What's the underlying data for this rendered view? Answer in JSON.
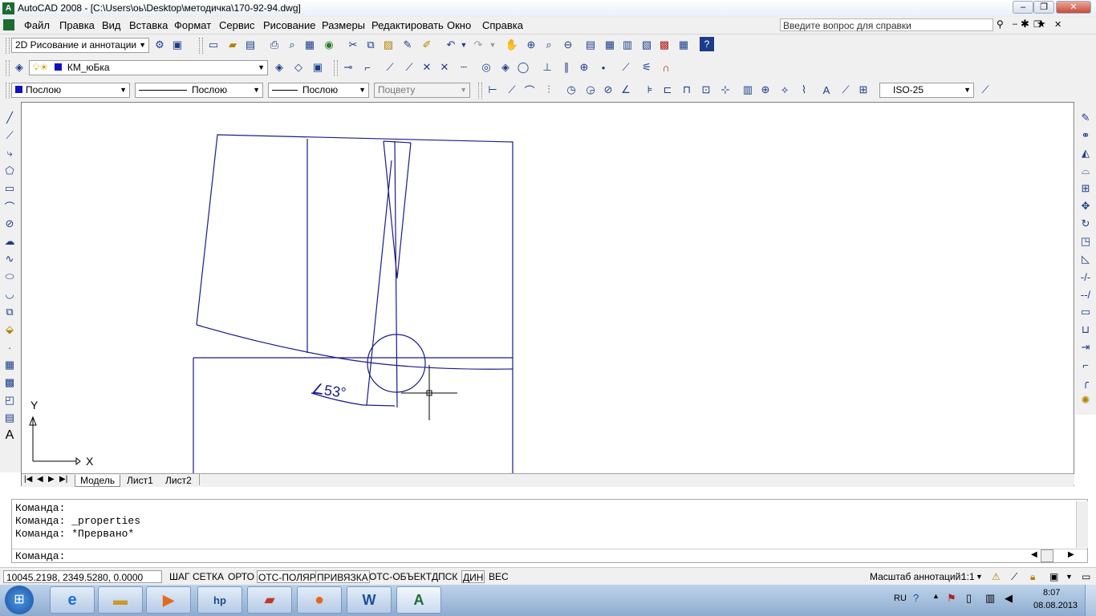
{
  "window": {
    "title": "AutoCAD 2008 - [C:\\Users\\оь\\Desktop\\методичка\\170-92-94.dwg]",
    "app_icon_label": "A",
    "minimize": "‒",
    "restore": "❐",
    "close": "✕"
  },
  "menu": {
    "items": [
      "Файл",
      "Правка",
      "Вид",
      "Вставка",
      "Формат",
      "Сервис",
      "Рисование",
      "Размеры",
      "Редактировать",
      "Окно",
      "Справка"
    ],
    "help_placeholder": "Введите вопрос для справки"
  },
  "toolbar1": {
    "workspace": "2D Рисование и аннотации"
  },
  "toolbar2": {
    "layer": "КМ_юБка"
  },
  "toolbar3": {
    "color": "Послою",
    "linetype": "Послою",
    "lineweight": "Послою",
    "plotstyle": "Поцвету",
    "dimstyle": "ISO-25"
  },
  "drawing": {
    "dimension_text": "∠53°",
    "ucs_x": "X",
    "ucs_y": "Y"
  },
  "tabs": [
    "Модель",
    "Лист1",
    "Лист2"
  ],
  "command": {
    "lines": [
      "Команда:",
      "Команда: _properties",
      "Команда: *Прервано*"
    ],
    "prompt": "Команда:"
  },
  "status": {
    "coords": "10045.2198, 2349.5280, 0.0000",
    "buttons": [
      "ШАГ",
      "СЕТКА",
      "ОРТО",
      "ОТС-ПОЛЯР",
      "ПРИВЯЗКА",
      "ОТС-ОБЪЕКТ",
      "ДПСК",
      "ДИН",
      "ВЕС"
    ],
    "annotation_scale_label": "Масштаб аннотаций:",
    "annotation_scale": "1:1"
  },
  "taskbar": {
    "lang": "RU",
    "time": "8:07",
    "date": "08.08.2013"
  }
}
